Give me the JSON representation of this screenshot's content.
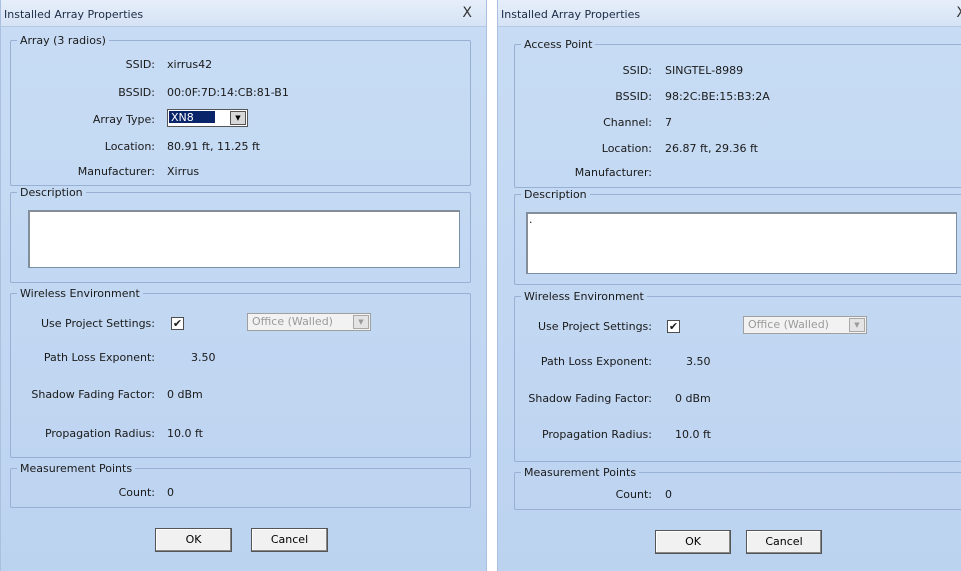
{
  "dialogs": [
    {
      "title": "Installed Array Properties",
      "close_glyph": "X",
      "group_main": {
        "legend": "Array (3 radios)",
        "rows": [
          {
            "label": "SSID:",
            "value": "xirrus42"
          },
          {
            "label": "BSSID:",
            "value": "00:0F:7D:14:CB:81-B1"
          },
          {
            "label": "Array Type:",
            "value": "XN8"
          },
          {
            "label": "Location:",
            "value": "80.91 ft, 11.25 ft"
          },
          {
            "label": "Manufacturer:",
            "value": "Xirrus"
          }
        ]
      },
      "description": {
        "legend": "Description",
        "text": ""
      },
      "wireless": {
        "legend": "Wireless Environment",
        "use_project_label": "Use Project Settings:",
        "checked": "✔",
        "environment": "Office (Walled)",
        "path_loss_label": "Path Loss Exponent:",
        "path_loss_value": "3.50",
        "shadow_label": "Shadow Fading Factor:",
        "shadow_value": "0 dBm",
        "radius_label": "Propagation Radius:",
        "radius_value": "10.0 ft"
      },
      "measurement": {
        "legend": "Measurement Points",
        "count_label": "Count:",
        "count_value": "0"
      },
      "buttons": {
        "ok": "OK",
        "cancel": "Cancel"
      }
    },
    {
      "title": "Installed Array Properties",
      "close_glyph": "X",
      "group_main": {
        "legend": "Access Point",
        "rows": [
          {
            "label": "SSID:",
            "value": "SINGTEL-8989"
          },
          {
            "label": "BSSID:",
            "value": "98:2C:BE:15:B3:2A"
          },
          {
            "label": "Channel:",
            "value": "7"
          },
          {
            "label": "Location:",
            "value": "26.87 ft, 29.36 ft"
          },
          {
            "label": "Manufacturer:",
            "value": ""
          }
        ]
      },
      "description": {
        "legend": "Description",
        "text": "."
      },
      "wireless": {
        "legend": "Wireless Environment",
        "use_project_label": "Use Project Settings:",
        "checked": "✔",
        "environment": "Office (Walled)",
        "path_loss_label": "Path Loss Exponent:",
        "path_loss_value": "3.50",
        "shadow_label": "Shadow Fading Factor:",
        "shadow_value": "0 dBm",
        "radius_label": "Propagation Radius:",
        "radius_value": "10.0 ft"
      },
      "measurement": {
        "legend": "Measurement Points",
        "count_label": "Count:",
        "count_value": "0"
      },
      "buttons": {
        "ok": "OK",
        "cancel": "Cancel"
      }
    }
  ],
  "dropdown_arrow": "▼"
}
